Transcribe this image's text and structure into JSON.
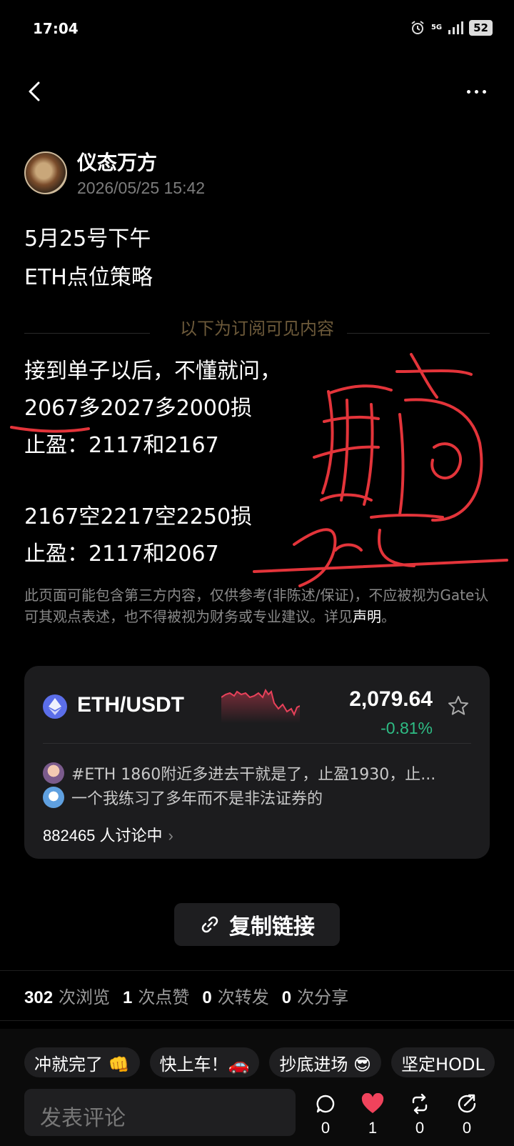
{
  "status_bar": {
    "time": "17:04",
    "network": "5G",
    "battery": "52"
  },
  "author": {
    "name": "仪态万方",
    "timestamp": "2026/05/25 15:42"
  },
  "post": {
    "title_lines": [
      "5月25号下午",
      "ETH点位策略"
    ],
    "divider": "以下为订阅可见内容",
    "body_lines": [
      "接到单子以后，不懂就问，",
      "2067多2027多2000损",
      "止盈：2117和2167",
      "2167空2217空2250损",
      "止盈：2117和2067"
    ],
    "disclaimer": "此页面可能包含第三方内容，仅供参考(非陈述/保证)，不应被视为Gate认可其观点表述，也不得被视为财务或专业建议。详见",
    "disclaimer_link": "声明",
    "disclaimer_end": "。"
  },
  "ticker": {
    "pair": "ETH/USDT",
    "price": "2,079.64",
    "change": "-0.81%",
    "change_color": "#2ebd85",
    "comments": [
      "#ETH 1860附近多进去干就是了，止盈1930，止...",
      "一个我练习了多年而不是非法证券的"
    ],
    "discussion": "882465 人讨论中"
  },
  "copy_button": "复制链接",
  "stats": [
    {
      "value": "302",
      "label": "次浏览"
    },
    {
      "value": "1",
      "label": "次点赞"
    },
    {
      "value": "0",
      "label": "次转发"
    },
    {
      "value": "0",
      "label": "次分享"
    }
  ],
  "reaction_chips": [
    "冲就完了 👊",
    "快上车！🚗",
    "抄底进场 😎",
    "坚定HODL"
  ],
  "comment_placeholder": "发表评论",
  "actions": [
    {
      "icon": "comment-icon",
      "count": "0"
    },
    {
      "icon": "heart-icon",
      "count": "1"
    },
    {
      "icon": "repost-icon",
      "count": "0"
    },
    {
      "icon": "share-icon",
      "count": "0"
    }
  ]
}
